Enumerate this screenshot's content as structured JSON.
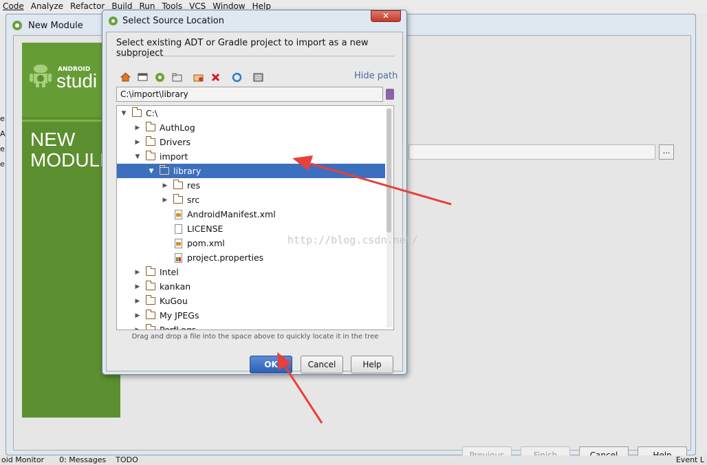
{
  "menubar": [
    "Code",
    "Analyze",
    "Refactor",
    "Build",
    "Run",
    "Tools",
    "VCS",
    "Window",
    "Help"
  ],
  "new_module": {
    "title": "New Module",
    "logo_sub": "ANDROID",
    "logo_main": "studi",
    "heading_line1": "NEW",
    "heading_line2": "MODULE",
    "browse_label": "...",
    "buttons": {
      "previous": "Previous",
      "finish": "Finish",
      "cancel": "Cancel",
      "help": "Help"
    }
  },
  "left_truncated": [
    "e.",
    "Ac",
    "e.",
    "e."
  ],
  "statusbar": [
    "oid Monitor",
    "0: Messages",
    "TODO",
    "Event L"
  ],
  "dialog": {
    "title": "Select Source Location",
    "header": "Select existing ADT or Gradle project to import as a new subproject",
    "hide_path": "Hide path",
    "path_value": "C:\\import\\library",
    "hint": "Drag and drop a file into the space above to quickly locate it in the tree",
    "ok": "OK",
    "cancel": "Cancel",
    "help": "Help",
    "toolbar_icons": [
      "home-icon",
      "desktop-icon",
      "android-project-icon",
      "module-icon",
      "new-folder-icon",
      "delete-icon",
      "refresh-icon",
      "show-hidden-icon"
    ],
    "tree": [
      {
        "label": "C:\\",
        "kind": "folder",
        "expanded": true,
        "depth": 0
      },
      {
        "label": "AuthLog",
        "kind": "folder",
        "expanded": false,
        "depth": 1
      },
      {
        "label": "Drivers",
        "kind": "folder",
        "expanded": false,
        "depth": 1
      },
      {
        "label": "import",
        "kind": "folder",
        "expanded": true,
        "depth": 1
      },
      {
        "label": "library",
        "kind": "folder",
        "expanded": true,
        "depth": 2,
        "selected": true
      },
      {
        "label": "res",
        "kind": "folder",
        "expanded": false,
        "depth": 3
      },
      {
        "label": "src",
        "kind": "folder",
        "expanded": false,
        "depth": 3
      },
      {
        "label": "AndroidManifest.xml",
        "kind": "xml",
        "depth": 3
      },
      {
        "label": "LICENSE",
        "kind": "file",
        "depth": 3
      },
      {
        "label": "pom.xml",
        "kind": "xml",
        "depth": 3
      },
      {
        "label": "project.properties",
        "kind": "props",
        "depth": 3
      },
      {
        "label": "Intel",
        "kind": "folder",
        "expanded": false,
        "depth": 1
      },
      {
        "label": "kankan",
        "kind": "folder",
        "expanded": false,
        "depth": 1
      },
      {
        "label": "KuGou",
        "kind": "folder",
        "expanded": false,
        "depth": 1
      },
      {
        "label": "My JPEGs",
        "kind": "folder",
        "expanded": false,
        "depth": 1
      },
      {
        "label": "PerfLogs",
        "kind": "folder",
        "expanded": false,
        "depth": 1
      }
    ]
  },
  "watermark": "http://blog.csdn.net/",
  "colors": {
    "selection": "#3d6fbf",
    "arrow": "#e8403a",
    "android_green": "#5c8f2f"
  }
}
